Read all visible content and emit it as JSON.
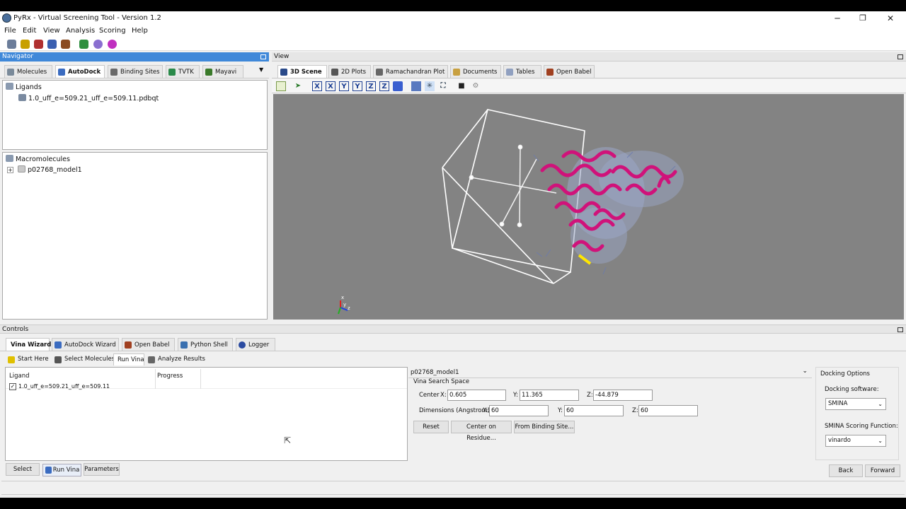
{
  "window": {
    "title": "PyRx - Virtual Screening Tool - Version 1.2",
    "minimize": "─",
    "maximize": "❐",
    "close": "✕"
  },
  "menu": [
    "File",
    "Edit",
    "View",
    "Analysis",
    "Scoring",
    "Help"
  ],
  "toolbar_icon_colors": [
    "#6b7d9a",
    "#c8a000",
    "#b03030",
    "#3a5fb0",
    "#8a4a20",
    "#2f8f3f",
    "#8a6fd0",
    "#c030c0"
  ],
  "navigator": {
    "title": "Navigator",
    "tabs": [
      {
        "label": "Molecules",
        "icon": "molecules-icon",
        "color": "#7a8a9a"
      },
      {
        "label": "AutoDock",
        "icon": "autodock-icon",
        "color": "#3a6bc0"
      },
      {
        "label": "Binding Sites",
        "icon": "binding-sites-icon",
        "color": "#6a6a6a"
      },
      {
        "label": "TVTK",
        "icon": "tvtk-icon",
        "color": "#2a8a4a"
      },
      {
        "label": "Mayavi",
        "icon": "mayavi-icon",
        "color": "#3a7a2a"
      }
    ],
    "ligands": {
      "heading": "Ligands",
      "items": [
        "1.0_uff_e=509.21_uff_e=509.11.pdbqt"
      ]
    },
    "macromolecules": {
      "heading": "Macromolecules",
      "items": [
        "p02768_model1"
      ]
    }
  },
  "view": {
    "title": "View",
    "tabs": [
      {
        "label": "3D Scene",
        "icon": "3d-scene-icon",
        "color": "#2a4a8a"
      },
      {
        "label": "2D Plots",
        "icon": "2d-plots-icon",
        "color": "#555"
      },
      {
        "label": "Ramachandran Plot",
        "icon": "ramachandran-icon",
        "color": "#666"
      },
      {
        "label": "Documents",
        "icon": "documents-icon",
        "color": "#c8a040"
      },
      {
        "label": "Tables",
        "icon": "tables-icon",
        "color": "#90a0c0"
      },
      {
        "label": "Open Babel",
        "icon": "open-babel-icon",
        "color": "#a04020"
      }
    ],
    "toolbar": [
      "X",
      "X",
      "Y",
      "Y",
      "Z",
      "Z"
    ],
    "axes": {
      "x": "x",
      "y": "y",
      "z": "z"
    }
  },
  "controls": {
    "title": "Controls",
    "tabs": [
      {
        "label": "Vina Wizard",
        "icon": "",
        "color": ""
      },
      {
        "label": "AutoDock Wizard",
        "icon": "autodock-wizard-icon",
        "color": "#3a6bc0"
      },
      {
        "label": "Open Babel",
        "icon": "open-babel-icon",
        "color": "#a04020"
      },
      {
        "label": "Python Shell",
        "icon": "python-icon",
        "color": "#3a70b0"
      },
      {
        "label": "Logger",
        "icon": "logger-icon",
        "color": "#2a4aa0"
      }
    ],
    "steps": [
      {
        "label": "Start Here",
        "icon": "bulb-icon",
        "color": "#e0c000"
      },
      {
        "label": "Select Molecules",
        "icon": "select-molecules-icon",
        "color": "#555"
      },
      {
        "label": "Run Vina",
        "icon": "",
        "color": ""
      },
      {
        "label": "Analyze Results",
        "icon": "analyze-results-icon",
        "color": "#666"
      }
    ],
    "table": {
      "columns": [
        "Ligand",
        "Progress"
      ],
      "rows": [
        {
          "ligand": "1.0_uff_e=509.21_uff_e=509.11",
          "checked": true,
          "progress": ""
        }
      ]
    },
    "search_space": {
      "model": "p02768_model1",
      "title": "Vina Search Space",
      "center_label": "Center",
      "center": {
        "x": "0.605",
        "y": "11.365",
        "z": "-44.879"
      },
      "dimensions_label": "Dimensions (Angstrom)",
      "dimensions": {
        "x": "60",
        "y": "60",
        "z": "60"
      },
      "axis_labels": {
        "x": "X:",
        "y": "Y:",
        "z": "Z:"
      },
      "buttons": [
        "Reset",
        "Center on Residue...",
        "From Binding Site..."
      ]
    },
    "docking_options": {
      "title": "Docking Options",
      "software_label": "Docking software:",
      "software": "SMINA",
      "scoring_label": "SMINA Scoring Function:",
      "scoring": "vinardo"
    },
    "bottom_buttons": [
      "Select",
      "Run Vina",
      "Parameters"
    ],
    "nav_buttons": [
      "Back",
      "Forward"
    ]
  }
}
